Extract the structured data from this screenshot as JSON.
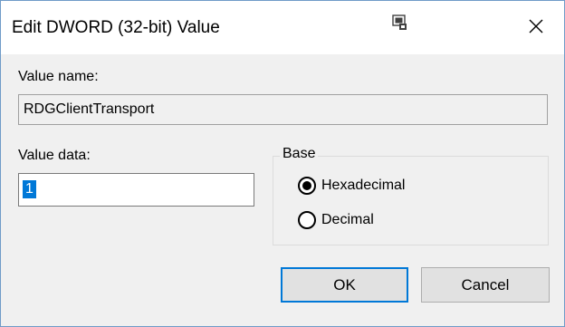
{
  "dialog": {
    "title": "Edit DWORD (32-bit) Value",
    "value_name_label": "Value name:",
    "value_name": "RDGClientTransport",
    "value_data_label": "Value data:",
    "value_data": "1",
    "base_label": "Base",
    "base_options": [
      {
        "label": "Hexadecimal",
        "selected": true
      },
      {
        "label": "Decimal",
        "selected": false
      }
    ],
    "ok_label": "OK",
    "cancel_label": "Cancel"
  },
  "icons": {
    "titlebar_pin": "screen-pin-icon",
    "close": "close-icon"
  },
  "colors": {
    "accent": "#0078d7",
    "window_border": "#6f9bc8",
    "dialog_bg": "#f0f0f0"
  }
}
